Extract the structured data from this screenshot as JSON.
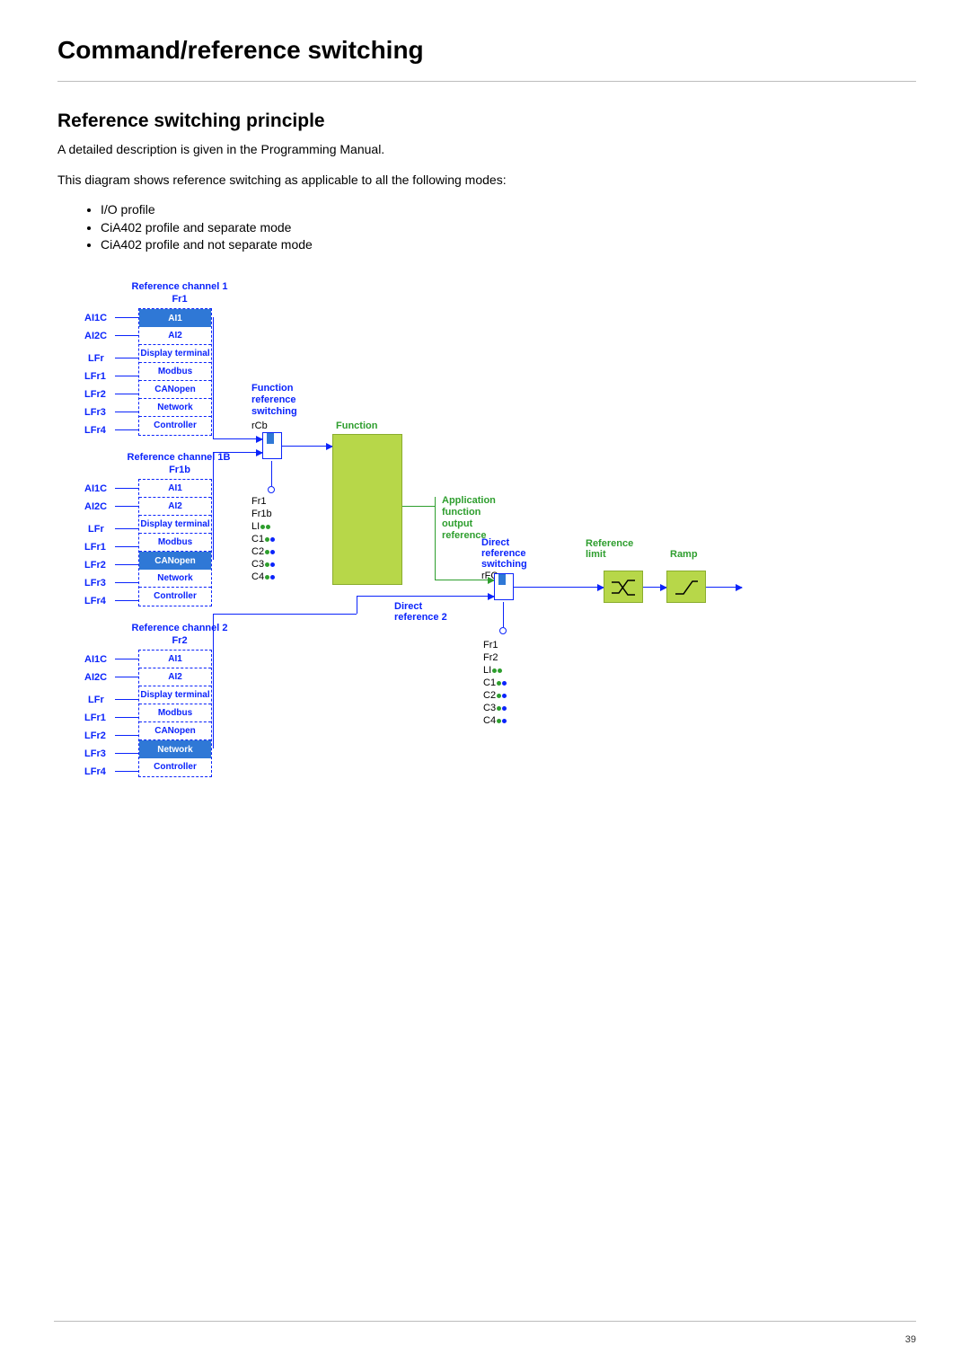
{
  "page_title": "Command/reference switching",
  "section_title": "Reference switching principle",
  "intro1": "A detailed description is given in the Programming Manual.",
  "intro2": "This diagram shows reference switching as applicable to all the following modes:",
  "bullets": [
    "I/O profile",
    "CiA402 profile and separate mode",
    "CiA402 profile and not separate mode"
  ],
  "page_number": "39",
  "diagram": {
    "channel_titles": [
      "Reference channel 1",
      "Reference channel 1B",
      "Reference channel 2"
    ],
    "channel_subs": [
      "Fr1",
      "Fr1b",
      "Fr2"
    ],
    "input_labels": [
      "AI1C",
      "AI2C",
      "LFr",
      "LFr1",
      "LFr2",
      "LFr3",
      "LFr4"
    ],
    "options": [
      "AI1",
      "AI2",
      "Display terminal",
      "Modbus",
      "CANopen",
      "Network",
      "Controller"
    ],
    "selected": {
      "ch1": 0,
      "ch1b": 4,
      "ch2": 5
    },
    "func_ref_switch": {
      "title": "Function",
      "line2": "reference",
      "line3": "switching",
      "param": "rCb"
    },
    "function_label": "Function",
    "app_out": {
      "l1": "Application",
      "l2": "function",
      "l3": "output",
      "l4": "reference"
    },
    "direct_ref_switch": {
      "title": "Direct",
      "line2": "reference",
      "line3": "switching",
      "param": "rFC"
    },
    "direct_ref2": "Direct\nreference 2",
    "ref_limit": "Reference\nlimit",
    "ramp": "Ramp",
    "switch1_opts": [
      "Fr1",
      "Fr1b",
      "LI",
      "C1",
      "C2",
      "C3",
      "C4"
    ],
    "switch2_opts": [
      "Fr1",
      "Fr2",
      "LI",
      "C1",
      "C2",
      "C3",
      "C4"
    ]
  },
  "chart_data": {
    "type": "diagram",
    "blocks": [
      {
        "id": "ch1",
        "title": "Reference channel 1 (Fr1)",
        "inputs": [
          "AI1C",
          "AI2C",
          "LFr",
          "LFr1",
          "LFr2",
          "LFr3",
          "LFr4"
        ],
        "options": [
          "AI1",
          "AI2",
          "Display terminal",
          "Modbus",
          "CANopen",
          "Network",
          "Controller"
        ],
        "selected": "AI1"
      },
      {
        "id": "ch1b",
        "title": "Reference channel 1B (Fr1b)",
        "inputs": [
          "AI1C",
          "AI2C",
          "LFr",
          "LFr1",
          "LFr2",
          "LFr3",
          "LFr4"
        ],
        "options": [
          "AI1",
          "AI2",
          "Display terminal",
          "Modbus",
          "CANopen",
          "Network",
          "Controller"
        ],
        "selected": "CANopen"
      },
      {
        "id": "ch2",
        "title": "Reference channel 2 (Fr2)",
        "inputs": [
          "AI1C",
          "AI2C",
          "LFr",
          "LFr1",
          "LFr2",
          "LFr3",
          "LFr4"
        ],
        "options": [
          "AI1",
          "AI2",
          "Display terminal",
          "Modbus",
          "CANopen",
          "Network",
          "Controller"
        ],
        "selected": "Network"
      },
      {
        "id": "rCb",
        "title": "Function reference switching (rCb)",
        "selector": [
          "Fr1",
          "Fr1b",
          "LI••",
          "C1••",
          "C2••",
          "C3••",
          "C4••"
        ]
      },
      {
        "id": "Function",
        "title": "Function",
        "output": "Application function output reference"
      },
      {
        "id": "rFC",
        "title": "Direct reference switching (rFC)",
        "selector": [
          "Fr1",
          "Fr2",
          "LI••",
          "C1••",
          "C2••",
          "C3••",
          "C4••"
        ],
        "secondary_input": "Direct reference 2"
      },
      {
        "id": "limit",
        "title": "Reference limit"
      },
      {
        "id": "ramp",
        "title": "Ramp"
      }
    ],
    "arrows": [
      [
        "ch1",
        "rCb"
      ],
      [
        "ch1b",
        "rCb"
      ],
      [
        "rCb",
        "Function"
      ],
      [
        "Function",
        "rFC"
      ],
      [
        "ch2",
        "rFC-direct2"
      ],
      [
        "rFC",
        "limit"
      ],
      [
        "limit",
        "ramp"
      ],
      [
        "ramp",
        "output"
      ]
    ]
  }
}
